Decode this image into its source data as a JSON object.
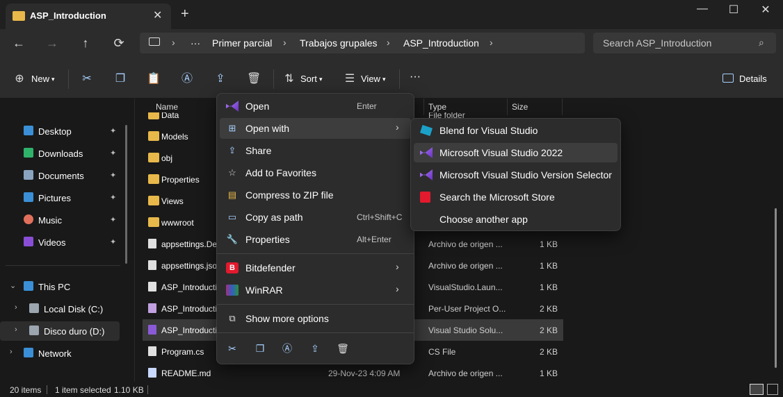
{
  "window": {
    "tab_title": "ASP_Introduction",
    "tab_close": "✕",
    "new_tab": "+",
    "minimize": "—",
    "maximize": "☐",
    "close": "✕"
  },
  "nav": {
    "back": "←",
    "forward": "→",
    "up": "↑",
    "refresh": "⟳"
  },
  "address": {
    "crumbs": [
      "Primer parcial",
      "Trabajos grupales",
      "ASP_Introduction"
    ],
    "more": "···",
    "sep": "›"
  },
  "search": {
    "placeholder": "Search ASP_Introduction",
    "icon": "⌕"
  },
  "toolbar": {
    "new_label": "New",
    "sort_label": "Sort",
    "view_label": "View",
    "details_label": "Details",
    "more": "···"
  },
  "sidebar": {
    "quick": [
      {
        "label": "Desktop",
        "color": "#3b8fd6"
      },
      {
        "label": "Downloads",
        "color": "#2fb36b"
      },
      {
        "label": "Documents",
        "color": "#8aa4c0"
      },
      {
        "label": "Pictures",
        "color": "#3b8fd6"
      },
      {
        "label": "Music",
        "color": "#e0705c"
      },
      {
        "label": "Videos",
        "color": "#8a4ed6"
      }
    ],
    "this_pc": "This PC",
    "drives": [
      "Local Disk (C:)",
      "Disco duro (D:)"
    ],
    "network": "Network",
    "pin": "📌"
  },
  "columns": {
    "name": "Name",
    "type": "Type",
    "size": "Size"
  },
  "files": [
    {
      "name": "Data",
      "date": "",
      "type": "File folder",
      "size": "",
      "kind": "folder"
    },
    {
      "name": "Models",
      "date": "",
      "type": "",
      "size": "",
      "kind": "folder"
    },
    {
      "name": "obj",
      "date": "",
      "type": "",
      "size": "",
      "kind": "folder"
    },
    {
      "name": "Properties",
      "date": "",
      "type": "",
      "size": "",
      "kind": "folder"
    },
    {
      "name": "Views",
      "date": "",
      "type": "",
      "size": "",
      "kind": "folder"
    },
    {
      "name": "wwwroot",
      "date": "",
      "type": "",
      "size": "",
      "kind": "folder"
    },
    {
      "name": "appsettings.De",
      "date": "",
      "type": "Archivo de origen ...",
      "size": "1 KB",
      "kind": "json"
    },
    {
      "name": "appsettings.jso",
      "date": "",
      "type": "Archivo de origen ...",
      "size": "1 KB",
      "kind": "json"
    },
    {
      "name": "ASP_Introducti",
      "date": "",
      "type": "VisualStudio.Laun...",
      "size": "1 KB",
      "kind": "file"
    },
    {
      "name": "ASP_Introducti",
      "date": "",
      "type": "Per-User Project O...",
      "size": "2 KB",
      "kind": "proj"
    },
    {
      "name": "ASP_Introducti",
      "date": "",
      "type": "Visual Studio Solu...",
      "size": "2 KB",
      "kind": "sln"
    },
    {
      "name": "Program.cs",
      "date": "",
      "type": "CS File",
      "size": "2 KB",
      "kind": "file"
    },
    {
      "name": "README.md",
      "date": "29-Nov-23 4:09 AM",
      "type": "Archivo de origen ...",
      "size": "1 KB",
      "kind": "md"
    }
  ],
  "status": {
    "count": "20 items",
    "selected": "1 item selected",
    "size": "1.10 KB"
  },
  "context_menu": {
    "open": "Open",
    "open_key": "Enter",
    "open_with": "Open with",
    "share": "Share",
    "favorites": "Add to Favorites",
    "zip": "Compress to ZIP file",
    "copy_path": "Copy as path",
    "copy_path_key": "Ctrl+Shift+C",
    "properties": "Properties",
    "properties_key": "Alt+Enter",
    "bitdefender": "Bitdefender",
    "winrar": "WinRAR",
    "more_options": "Show more options",
    "arrow": "›"
  },
  "submenu": {
    "items": [
      "Blend for Visual Studio",
      "Microsoft Visual Studio 2022",
      "Microsoft Visual Studio Version Selector",
      "Search the Microsoft Store",
      "Choose another app"
    ]
  }
}
